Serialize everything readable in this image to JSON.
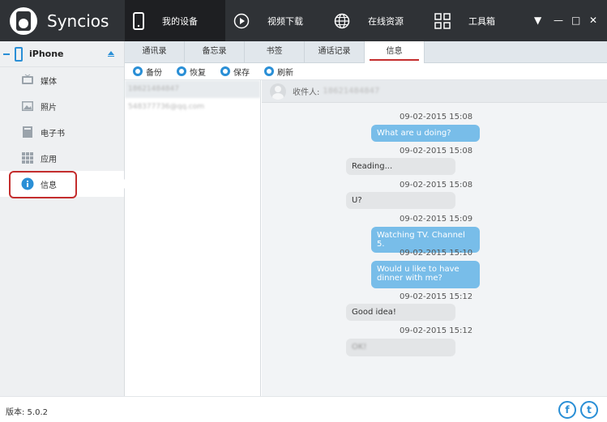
{
  "app": {
    "name": "Syncios",
    "version": "版本: 5.0.2"
  },
  "nav": [
    {
      "label": "我的设备",
      "icon": "phone-icon"
    },
    {
      "label": "视频下载",
      "icon": "play-icon"
    },
    {
      "label": "在线资源",
      "icon": "globe-icon"
    },
    {
      "label": "工具箱",
      "icon": "grid-icon"
    }
  ],
  "window_controls": [
    "▼",
    "—",
    "□",
    "✕"
  ],
  "device": {
    "name": "iPhone"
  },
  "sidebar": {
    "items": [
      {
        "label": "媒体",
        "icon": "tv-icon"
      },
      {
        "label": "照片",
        "icon": "photo-icon"
      },
      {
        "label": "电子书",
        "icon": "book-icon"
      },
      {
        "label": "应用",
        "icon": "apps-icon"
      },
      {
        "label": "信息",
        "icon": "info-icon"
      }
    ]
  },
  "tabs": [
    "通讯录",
    "备忘录",
    "书签",
    "通话记录",
    "信息"
  ],
  "toolbar": {
    "backup": "备份",
    "restore": "恢复",
    "save": "保存",
    "refresh": "刷新"
  },
  "contacts": [
    "18621484847",
    "548377736@qq.com"
  ],
  "chat": {
    "recipient_label": "收件人:",
    "recipient_value": "18621484847",
    "messages": [
      {
        "time": "09-02-2015 15:08",
        "text": "What are u doing?",
        "dir": "out"
      },
      {
        "time": "09-02-2015 15:08",
        "text": "Reading...",
        "dir": "in"
      },
      {
        "time": "09-02-2015 15:08",
        "text": "U?",
        "dir": "in"
      },
      {
        "time": "09-02-2015 15:09",
        "text": "Watching TV. Channel 5.",
        "dir": "out"
      },
      {
        "time": "09-02-2015 15:10",
        "text": "Would u like to have dinner with me?",
        "dir": "out"
      },
      {
        "time": "09-02-2015 15:12",
        "text": "Good idea!",
        "dir": "in"
      },
      {
        "time": "09-02-2015 15:12",
        "text": "OK!",
        "dir": "in"
      }
    ]
  },
  "social": {
    "facebook": "f",
    "twitter": "t"
  },
  "colors": {
    "accent": "#2a8fd6",
    "topbar": "#2f3236",
    "highlight": "#c42d2d",
    "bubble_out": "#78bde9",
    "bubble_in": "#e3e5e7"
  }
}
